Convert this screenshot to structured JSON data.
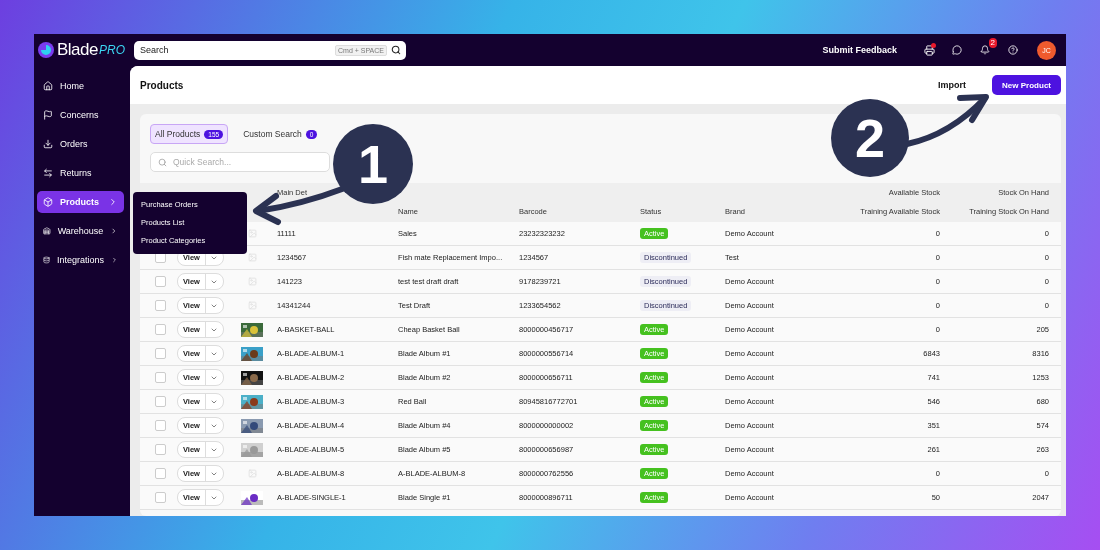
{
  "brand": {
    "name": "Blade",
    "suffix": "PRO"
  },
  "search": {
    "placeholder": "Search",
    "shortcut": "Cmd + SPACE"
  },
  "topbar": {
    "feedback": "Submit Feedback",
    "printer_alert": true,
    "notifications": "2",
    "avatar": "JC"
  },
  "sidebar": {
    "items": [
      {
        "label": "Home",
        "selected": false,
        "has_submenu": false
      },
      {
        "label": "Concerns",
        "selected": false,
        "has_submenu": false
      },
      {
        "label": "Orders",
        "selected": false,
        "has_submenu": false
      },
      {
        "label": "Returns",
        "selected": false,
        "has_submenu": false
      },
      {
        "label": "Products",
        "selected": true,
        "has_submenu": true
      },
      {
        "label": "Warehouse",
        "selected": false,
        "has_submenu": true
      },
      {
        "label": "Integrations",
        "selected": false,
        "has_submenu": true
      }
    ]
  },
  "submenu": [
    "Purchase Orders",
    "Products List",
    "Product Categories"
  ],
  "page": {
    "title": "Products",
    "actions": {
      "secondary": "Import",
      "primary": "New Product"
    }
  },
  "tabs": [
    {
      "label": "All Products",
      "count": "155",
      "selected": true
    },
    {
      "label": "Custom Search",
      "count": "0",
      "selected": false
    }
  ],
  "quick_search": {
    "placeholder": "Quick Search..."
  },
  "table": {
    "groups": [
      "Main Det",
      "Available Stock",
      "Stock On Hand"
    ],
    "columns": [
      "Name",
      "Barcode",
      "Status",
      "Brand",
      "Training Available Stock",
      "Training Stock On Hand"
    ],
    "rows": [
      {
        "thumbnail": {
          "kind": "placeholder"
        },
        "sku": "11111",
        "name": "Sales",
        "barcode": "23232323232",
        "status": {
          "label": "Active",
          "kind": "active"
        },
        "brand": "Demo Account",
        "available": "0",
        "on_hand": "0"
      },
      {
        "checked": false,
        "view": "View",
        "thumbnail": {
          "kind": "placeholder"
        },
        "sku": "1234567",
        "name": "Fish mate Replacement Impo...",
        "barcode": "1234567",
        "status": {
          "label": "Discontinued",
          "kind": "discontinued"
        },
        "brand": "Test",
        "available": "0",
        "on_hand": "0"
      },
      {
        "checked": false,
        "view": "View",
        "thumbnail": {
          "kind": "placeholder"
        },
        "sku": "141223",
        "name": "test test draft draft",
        "barcode": "9178239721",
        "status": {
          "label": "Discontinued",
          "kind": "discontinued"
        },
        "brand": "Demo Account",
        "available": "0",
        "on_hand": "0"
      },
      {
        "checked": false,
        "view": "View",
        "thumbnail": {
          "kind": "placeholder"
        },
        "sku": "14341244",
        "name": "Test Draft",
        "barcode": "1233654562",
        "status": {
          "label": "Discontinued",
          "kind": "discontinued"
        },
        "brand": "Demo Account",
        "available": "0",
        "on_hand": "0"
      },
      {
        "checked": false,
        "view": "View",
        "sku": "A-BASKET-BALL",
        "name": "Cheap Basket Ball",
        "barcode": "8000000456717",
        "status": {
          "label": "Active",
          "kind": "active"
        },
        "brand": "Demo Account",
        "available": "0",
        "on_hand": "205"
      },
      {
        "checked": false,
        "view": "View",
        "sku": "A-BLADE-ALBUM-1",
        "name": "Blade Album #1",
        "barcode": "8000000556714",
        "status": {
          "label": "Active",
          "kind": "active"
        },
        "brand": "Demo Account",
        "available": "6843",
        "on_hand": "8316"
      },
      {
        "checked": false,
        "view": "View",
        "sku": "A-BLADE-ALBUM-2",
        "name": "Blade Album #2",
        "barcode": "8000000656711",
        "status": {
          "label": "Active",
          "kind": "active"
        },
        "brand": "Demo Account",
        "available": "741",
        "on_hand": "1253"
      },
      {
        "checked": false,
        "view": "View",
        "sku": "A-BLADE-ALBUM-3",
        "name": "Red Ball",
        "barcode": "80945816772701",
        "status": {
          "label": "Active",
          "kind": "active"
        },
        "brand": "Demo Account",
        "available": "546",
        "on_hand": "680"
      },
      {
        "checked": false,
        "view": "View",
        "sku": "A-BLADE-ALBUM-4",
        "name": "Blade Album #4",
        "barcode": "8000000000002",
        "status": {
          "label": "Active",
          "kind": "active"
        },
        "brand": "Demo Account",
        "available": "351",
        "on_hand": "574"
      },
      {
        "checked": false,
        "view": "View",
        "sku": "A-BLADE-ALBUM-5",
        "name": "Blade Album #5",
        "barcode": "8000000656987",
        "status": {
          "label": "Active",
          "kind": "active"
        },
        "brand": "Demo Account",
        "available": "261",
        "on_hand": "263"
      },
      {
        "checked": false,
        "view": "View",
        "thumbnail": {
          "kind": "placeholder"
        },
        "sku": "A-BLADE-ALBUM-8",
        "name": "A-BLADE-ALBUM-8",
        "barcode": "8000000762556",
        "status": {
          "label": "Active",
          "kind": "active"
        },
        "brand": "Demo Account",
        "available": "0",
        "on_hand": "0"
      },
      {
        "checked": false,
        "view": "View",
        "sku": "A-BLADE-SINGLE-1",
        "name": "Blade Single #1",
        "barcode": "8000000896711",
        "status": {
          "label": "Active",
          "kind": "active"
        },
        "brand": "Demo Account",
        "available": "50",
        "on_hand": "2047"
      }
    ]
  },
  "callouts": [
    "1",
    "2"
  ]
}
